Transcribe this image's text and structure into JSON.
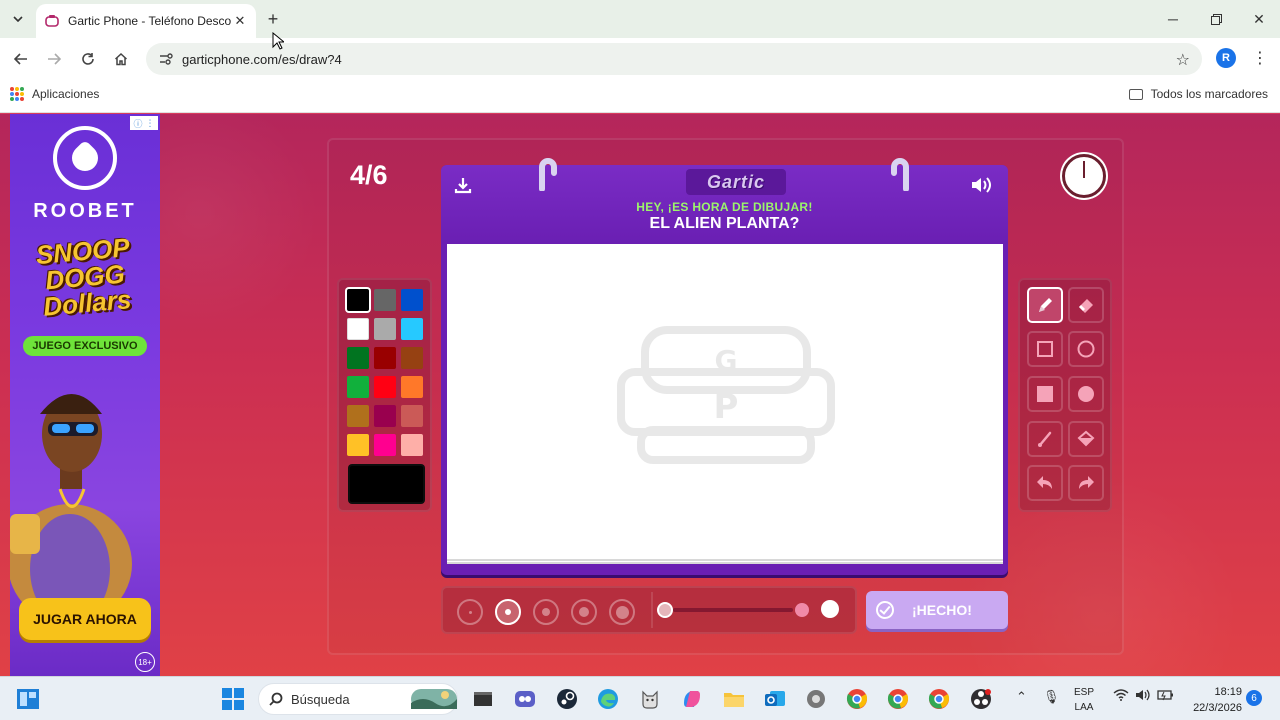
{
  "browser": {
    "tab_title": "Gartic Phone - Teléfono Descon",
    "url": "garticphone.com/es/draw?4",
    "profile_initial": "R",
    "bookmarks_apps": "Aplicaciones",
    "bookmarks_all": "Todos los marcadores"
  },
  "ad": {
    "brand": "ROOBET",
    "title": "SNOOP DOGG Dollars",
    "exclusive": "JUEGO EXCLUSIVO",
    "cta": "JUGAR AHORA",
    "age": "18+"
  },
  "game": {
    "round": "4/6",
    "brand": "Gartic",
    "prompt_top": "HEY, ¡ES HORA DE DIBUJAR!",
    "prompt_main": "EL ALIEN PLANTA?",
    "done_label": "¡HECHO!",
    "palette": [
      [
        "#000000",
        "#666666",
        "#0050cd"
      ],
      [
        "#ffffff",
        "#aaaaaa",
        "#26c9ff"
      ],
      [
        "#017420",
        "#990000",
        "#964112"
      ],
      [
        "#11b03c",
        "#ff0013",
        "#ff7829"
      ],
      [
        "#b0701c",
        "#99004e",
        "#cb5a57"
      ],
      [
        "#ffc126",
        "#ff008f",
        "#feafa8"
      ]
    ],
    "selected_color": "#000000",
    "brush_sizes": 5,
    "active_size_index": 1,
    "active_tool": "pencil",
    "tools": [
      "pencil",
      "eraser",
      "rect-outline",
      "ellipse-outline",
      "rect-fill",
      "ellipse-fill",
      "line",
      "fill-bucket",
      "undo",
      "redo"
    ]
  },
  "taskbar": {
    "search_placeholder": "Búsqueda",
    "lang_top": "ESP",
    "lang_bottom": "LAA",
    "time": "18:19",
    "date": "22/3/2026",
    "notifications": "6"
  }
}
